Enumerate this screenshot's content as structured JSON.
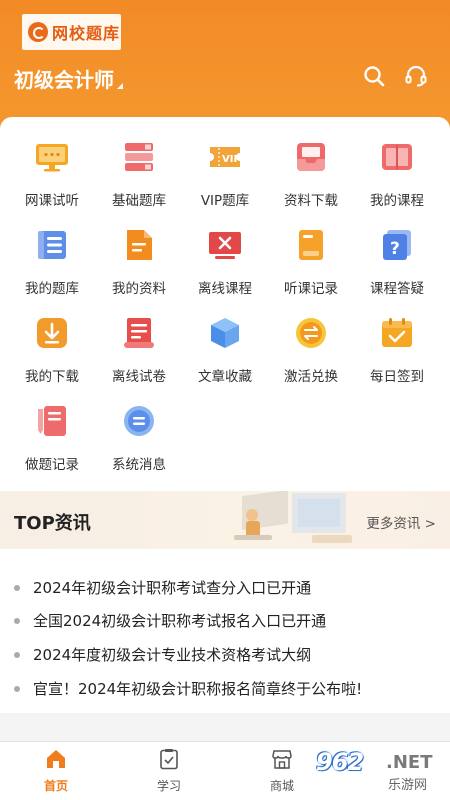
{
  "header": {
    "logo_text": "网校题库",
    "exam_title": "初级会计师",
    "colors": {
      "brand": "#f28a26",
      "brand_dark": "#e35d13"
    }
  },
  "grid_items": [
    {
      "label": "网课试听",
      "icon": "monitor-icon"
    },
    {
      "label": "基础题库",
      "icon": "book-stack-icon"
    },
    {
      "label": "VIP题库",
      "icon": "vip-ticket-icon"
    },
    {
      "label": "资料下载",
      "icon": "inbox-download-icon"
    },
    {
      "label": "我的课程",
      "icon": "open-book-icon"
    },
    {
      "label": "我的题库",
      "icon": "list-book-icon"
    },
    {
      "label": "我的资料",
      "icon": "document-icon"
    },
    {
      "label": "离线课程",
      "icon": "offline-screen-icon"
    },
    {
      "label": "听课记录",
      "icon": "record-card-icon"
    },
    {
      "label": "课程答疑",
      "icon": "question-icon"
    },
    {
      "label": "我的下载",
      "icon": "download-icon"
    },
    {
      "label": "离线试卷",
      "icon": "paper-scroll-icon"
    },
    {
      "label": "文章收藏",
      "icon": "cube-icon"
    },
    {
      "label": "激活兑换",
      "icon": "exchange-icon"
    },
    {
      "label": "每日签到",
      "icon": "checkin-icon"
    },
    {
      "label": "做题记录",
      "icon": "pencil-notes-icon"
    },
    {
      "label": "系统消息",
      "icon": "message-icon"
    }
  ],
  "news": {
    "title": "TOP资讯",
    "more": "更多资讯 >",
    "items": [
      "2024年初级会计职称考试查分入口已开通",
      "全国2024初级会计职称考试报名入口已开通",
      "2024年度初级会计专业技术资格考试大纲",
      "官宣！2024年初级会计职称报名简章终于公布啦!"
    ]
  },
  "tabbar": {
    "tabs": [
      {
        "label": "首页",
        "icon": "home-icon",
        "active": true
      },
      {
        "label": "学习",
        "icon": "study-icon",
        "active": false
      },
      {
        "label": "商城",
        "icon": "store-icon",
        "active": false
      }
    ]
  },
  "watermark": {
    "number": "962",
    "net": ".NET",
    "cn": "乐游网"
  }
}
